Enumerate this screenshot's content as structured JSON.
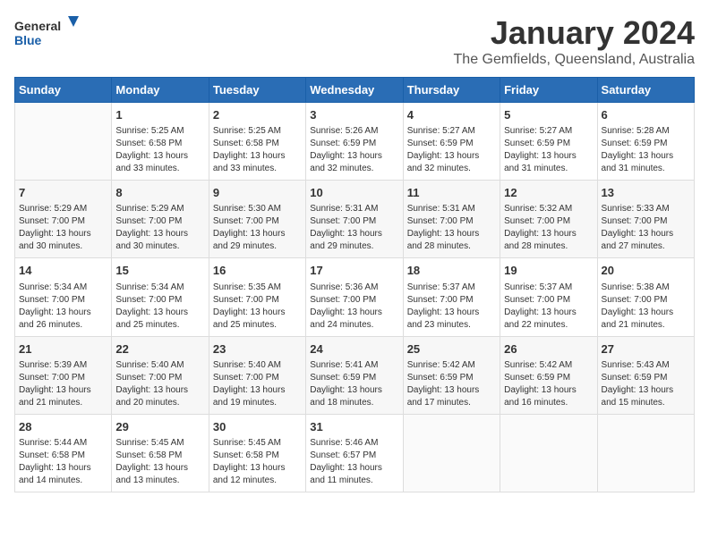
{
  "header": {
    "logo_general": "General",
    "logo_blue": "Blue",
    "title": "January 2024",
    "subtitle": "The Gemfields, Queensland, Australia"
  },
  "days_of_week": [
    "Sunday",
    "Monday",
    "Tuesday",
    "Wednesday",
    "Thursday",
    "Friday",
    "Saturday"
  ],
  "weeks": [
    [
      {
        "day": "",
        "info": ""
      },
      {
        "day": "1",
        "info": "Sunrise: 5:25 AM\nSunset: 6:58 PM\nDaylight: 13 hours\nand 33 minutes."
      },
      {
        "day": "2",
        "info": "Sunrise: 5:25 AM\nSunset: 6:58 PM\nDaylight: 13 hours\nand 33 minutes."
      },
      {
        "day": "3",
        "info": "Sunrise: 5:26 AM\nSunset: 6:59 PM\nDaylight: 13 hours\nand 32 minutes."
      },
      {
        "day": "4",
        "info": "Sunrise: 5:27 AM\nSunset: 6:59 PM\nDaylight: 13 hours\nand 32 minutes."
      },
      {
        "day": "5",
        "info": "Sunrise: 5:27 AM\nSunset: 6:59 PM\nDaylight: 13 hours\nand 31 minutes."
      },
      {
        "day": "6",
        "info": "Sunrise: 5:28 AM\nSunset: 6:59 PM\nDaylight: 13 hours\nand 31 minutes."
      }
    ],
    [
      {
        "day": "7",
        "info": "Sunrise: 5:29 AM\nSunset: 7:00 PM\nDaylight: 13 hours\nand 30 minutes."
      },
      {
        "day": "8",
        "info": "Sunrise: 5:29 AM\nSunset: 7:00 PM\nDaylight: 13 hours\nand 30 minutes."
      },
      {
        "day": "9",
        "info": "Sunrise: 5:30 AM\nSunset: 7:00 PM\nDaylight: 13 hours\nand 29 minutes."
      },
      {
        "day": "10",
        "info": "Sunrise: 5:31 AM\nSunset: 7:00 PM\nDaylight: 13 hours\nand 29 minutes."
      },
      {
        "day": "11",
        "info": "Sunrise: 5:31 AM\nSunset: 7:00 PM\nDaylight: 13 hours\nand 28 minutes."
      },
      {
        "day": "12",
        "info": "Sunrise: 5:32 AM\nSunset: 7:00 PM\nDaylight: 13 hours\nand 28 minutes."
      },
      {
        "day": "13",
        "info": "Sunrise: 5:33 AM\nSunset: 7:00 PM\nDaylight: 13 hours\nand 27 minutes."
      }
    ],
    [
      {
        "day": "14",
        "info": "Sunrise: 5:34 AM\nSunset: 7:00 PM\nDaylight: 13 hours\nand 26 minutes."
      },
      {
        "day": "15",
        "info": "Sunrise: 5:34 AM\nSunset: 7:00 PM\nDaylight: 13 hours\nand 25 minutes."
      },
      {
        "day": "16",
        "info": "Sunrise: 5:35 AM\nSunset: 7:00 PM\nDaylight: 13 hours\nand 25 minutes."
      },
      {
        "day": "17",
        "info": "Sunrise: 5:36 AM\nSunset: 7:00 PM\nDaylight: 13 hours\nand 24 minutes."
      },
      {
        "day": "18",
        "info": "Sunrise: 5:37 AM\nSunset: 7:00 PM\nDaylight: 13 hours\nand 23 minutes."
      },
      {
        "day": "19",
        "info": "Sunrise: 5:37 AM\nSunset: 7:00 PM\nDaylight: 13 hours\nand 22 minutes."
      },
      {
        "day": "20",
        "info": "Sunrise: 5:38 AM\nSunset: 7:00 PM\nDaylight: 13 hours\nand 21 minutes."
      }
    ],
    [
      {
        "day": "21",
        "info": "Sunrise: 5:39 AM\nSunset: 7:00 PM\nDaylight: 13 hours\nand 21 minutes."
      },
      {
        "day": "22",
        "info": "Sunrise: 5:40 AM\nSunset: 7:00 PM\nDaylight: 13 hours\nand 20 minutes."
      },
      {
        "day": "23",
        "info": "Sunrise: 5:40 AM\nSunset: 7:00 PM\nDaylight: 13 hours\nand 19 minutes."
      },
      {
        "day": "24",
        "info": "Sunrise: 5:41 AM\nSunset: 6:59 PM\nDaylight: 13 hours\nand 18 minutes."
      },
      {
        "day": "25",
        "info": "Sunrise: 5:42 AM\nSunset: 6:59 PM\nDaylight: 13 hours\nand 17 minutes."
      },
      {
        "day": "26",
        "info": "Sunrise: 5:42 AM\nSunset: 6:59 PM\nDaylight: 13 hours\nand 16 minutes."
      },
      {
        "day": "27",
        "info": "Sunrise: 5:43 AM\nSunset: 6:59 PM\nDaylight: 13 hours\nand 15 minutes."
      }
    ],
    [
      {
        "day": "28",
        "info": "Sunrise: 5:44 AM\nSunset: 6:58 PM\nDaylight: 13 hours\nand 14 minutes."
      },
      {
        "day": "29",
        "info": "Sunrise: 5:45 AM\nSunset: 6:58 PM\nDaylight: 13 hours\nand 13 minutes."
      },
      {
        "day": "30",
        "info": "Sunrise: 5:45 AM\nSunset: 6:58 PM\nDaylight: 13 hours\nand 12 minutes."
      },
      {
        "day": "31",
        "info": "Sunrise: 5:46 AM\nSunset: 6:57 PM\nDaylight: 13 hours\nand 11 minutes."
      },
      {
        "day": "",
        "info": ""
      },
      {
        "day": "",
        "info": ""
      },
      {
        "day": "",
        "info": ""
      }
    ]
  ]
}
